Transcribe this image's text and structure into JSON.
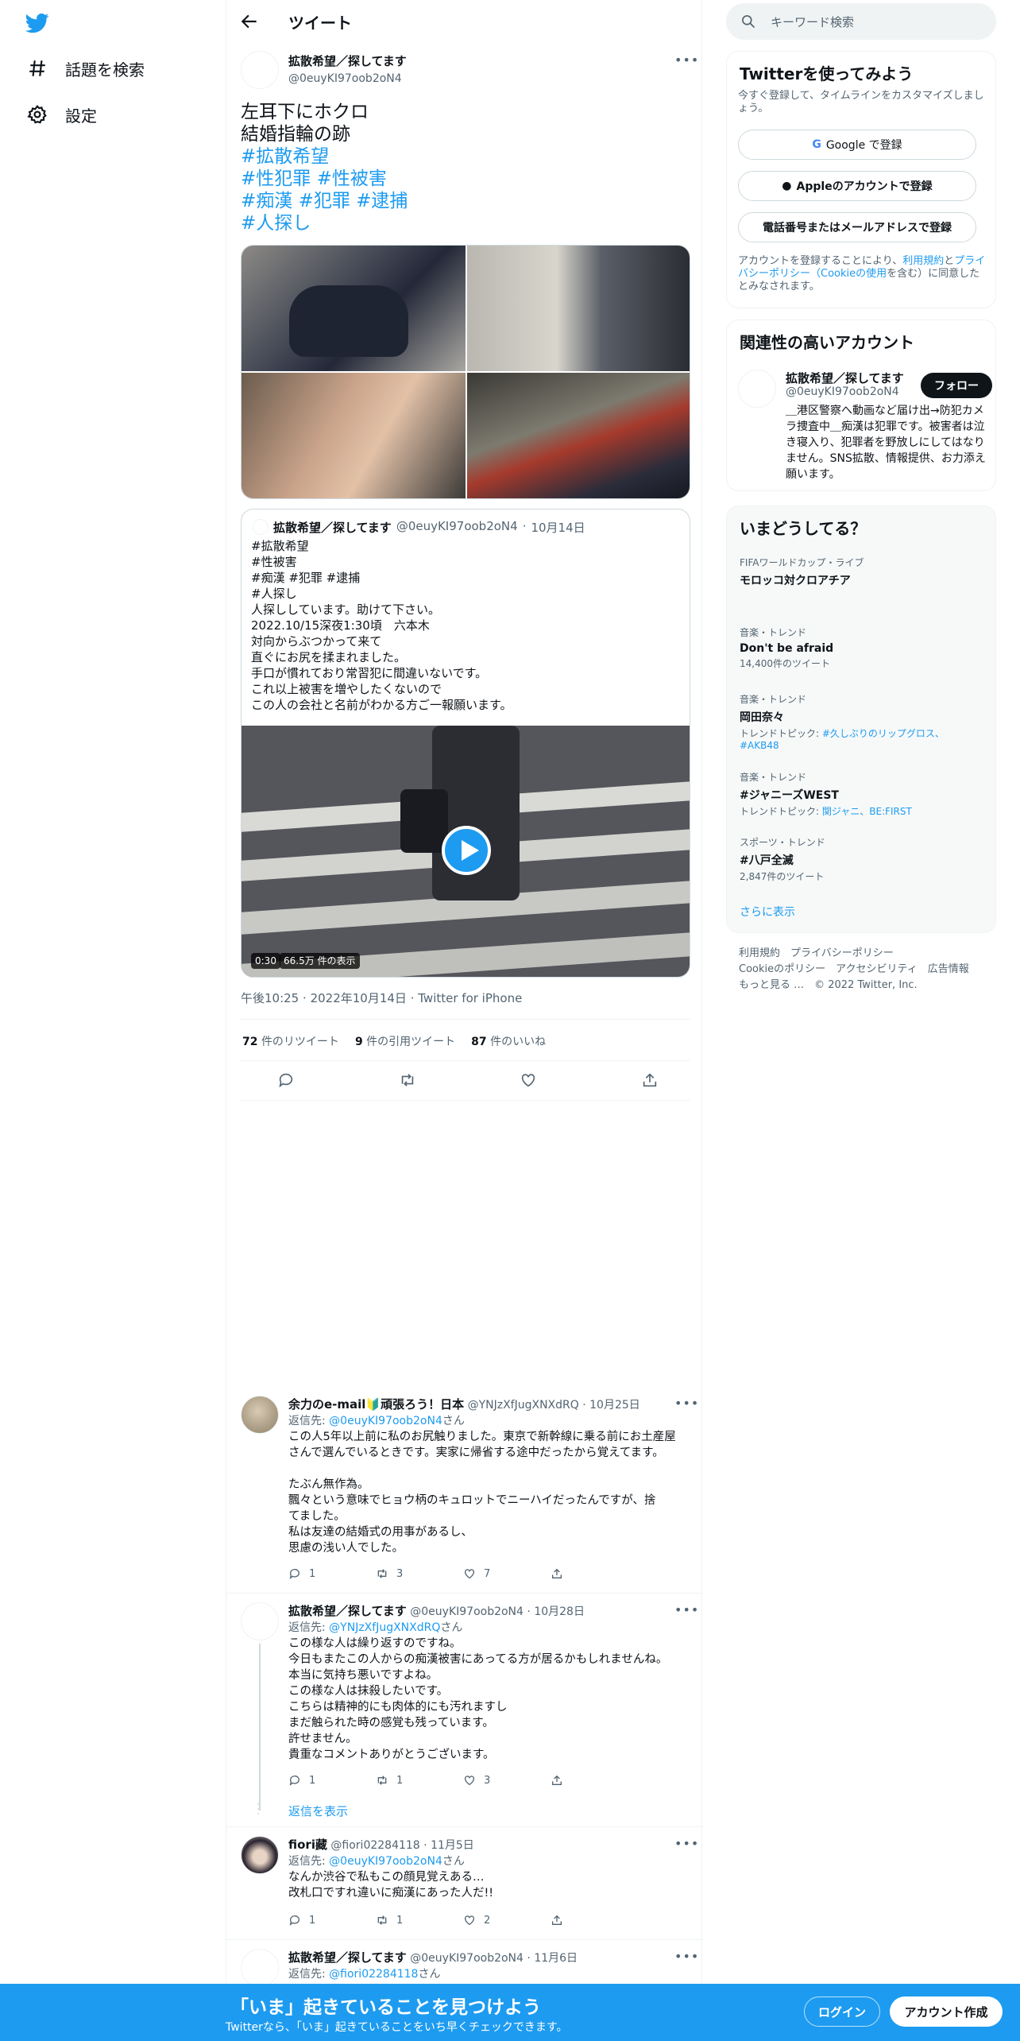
{
  "nav": {
    "items": [
      {
        "label": "話題を検索",
        "icon": "hashtag-icon"
      },
      {
        "label": "設定",
        "icon": "gear-icon"
      }
    ]
  },
  "header": {
    "title": "ツイート"
  },
  "tweet": {
    "author_name": "拡散希望／探してます",
    "author_handle": "@0euyKI97oob2oN4",
    "lines": [
      "左耳下にホクロ",
      "結婚指輪の跡"
    ],
    "hashtag_lines": [
      "#拡散希望",
      "#性犯罪 #性被害",
      "#痴漢 #犯罪 #逮捕",
      "#人探し"
    ],
    "time": "午後10:25",
    "date": "2022年10月14日",
    "source": "Twitter for iPhone",
    "stats": {
      "retweets_num": "72",
      "retweets_label": "件のリツイート",
      "quotes_num": "9",
      "quotes_label": "件の引用ツイート",
      "likes_num": "87",
      "likes_label": "件のいいね"
    }
  },
  "quote": {
    "author_name": "拡散希望／探してます",
    "author_handle": "@0euyKI97oob2oN4",
    "date": "10月14日",
    "lines": [
      "#拡散希望",
      "#性被害",
      "#痴漢 #犯罪 #逮捕",
      "#人探し",
      "人探ししています。助けて下さい。",
      "2022.10/15深夜1:30頃　六本木",
      "対向からぶつかって来て",
      "直ぐにお尻を揉まれました。",
      "手口が慣れており常習犯に間違いないです。",
      "これ以上被害を増やしたくないので",
      "この人の会社と名前がわかる方ご一報願います。"
    ],
    "video_duration": "0:30",
    "video_views": "66.5万 件の表示"
  },
  "replies": [
    {
      "name": "余力のe-mail🔰頑張ろう！日本",
      "handle": "@YNJzXfJugXNXdRQ",
      "date": "10月25日",
      "to_prefix": "返信先: ",
      "to": "@0euyKI97oob2oN4",
      "to_suffix": "さん",
      "lines": [
        "この人5年以上前に私のお尻触りました。東京で新幹線に乗る前にお土産屋",
        "さんで選んでいるときです。実家に帰省する途中だったから覚えてます。",
        "",
        "たぶん無作為。",
        "飄々という意味でヒョウ柄のキュロットでニーハイだったんですが、捨",
        "てました。",
        "私は友達の結婚式の用事があるし、",
        "思慮の浅い人でした。"
      ],
      "replies": "1",
      "retweets": "3",
      "likes": "7"
    },
    {
      "name": "拡散希望／探してます",
      "handle": "@0euyKI97oob2oN4",
      "date": "10月28日",
      "to_prefix": "返信先: ",
      "to": "@YNJzXfJugXNXdRQ",
      "to_suffix": "さん",
      "lines": [
        "この様な人は繰り返すのですね。",
        "今日もまたこの人からの痴漢被害にあってる方が居るかもしれませんね。",
        "本当に気持ち悪いですよね。",
        "この様な人は抹殺したいです。",
        "こちらは精神的にも肉体的にも汚れますし",
        "まだ触られた時の感覚も残っています。",
        "許せません。",
        "貴重なコメントありがとうございます。"
      ],
      "replies": "1",
      "retweets": "1",
      "likes": "3",
      "show_replies": "返信を表示"
    },
    {
      "name": "fiori藏",
      "handle": "@fiori02284118",
      "date": "11月5日",
      "to_prefix": "返信先: ",
      "to": "@0euyKI97oob2oN4",
      "to_suffix": "さん",
      "lines": [
        "なんか渋谷で私もこの顔見覚えある…",
        "改札口ですれ違いに痴漢にあった人だ!!"
      ],
      "replies": "1",
      "retweets": "1",
      "likes": "2"
    },
    {
      "name": "拡散希望／探してます",
      "handle": "@0euyKI97oob2oN4",
      "date": "11月6日",
      "to_prefix": "返信先: ",
      "to": "@fiori02284118",
      "to_suffix": "さん"
    }
  ],
  "search": {
    "placeholder": "キーワード検索"
  },
  "signup_card": {
    "title": "Twitterを使ってみよう",
    "subtitle": "今すぐ登録して、タイムラインをカスタマイズしましょう。",
    "google": "Google で登録",
    "apple": "Appleのアカウントで登録",
    "phone": "電話番号またはメールアドレスで登録",
    "terms_1": "アカウントを登録することにより、",
    "terms_link1": "利用規約",
    "terms_2": "と",
    "terms_link2": "プライバシーポリシー（Cookieの使用",
    "terms_3": "を含む）に同意したとみなされます。"
  },
  "related": {
    "title": "関連性の高いアカウント",
    "name": "拡散希望／探してます",
    "handle": "@0euyKI97oob2oN4",
    "follow": "フォロー",
    "bio": "＿港区警察へ動画など届け出→防犯カメラ捜査中＿痴漢は犯罪です。被害者は泣き寝入り、犯罪者を野放しにしてはなりません。SNS拡散、情報提供、お力添え願います。"
  },
  "trends": {
    "title": "いまどうしてる？",
    "items": [
      {
        "context": "FIFAワールドカップ・ライブ",
        "title": "モロッコ対クロアチア",
        "sub": ""
      },
      {
        "context": "音楽・トレンド",
        "title": "Don't be afraid",
        "sub": "14,400件のツイート"
      },
      {
        "context": "音楽・トレンド",
        "title": "岡田奈々",
        "sub_prefix": "トレンドトピック: ",
        "sub_links": "#久しぶりのリップグロス、#AKB48"
      },
      {
        "context": "音楽・トレンド",
        "title": "#ジャニーズWEST",
        "sub_prefix": "トレンドトピック: ",
        "sub_links": "関ジャニ、BE:FIRST"
      },
      {
        "context": "スポーツ・トレンド",
        "title": "#八戸全滅",
        "sub": "2,847件のツイート"
      }
    ],
    "show_more": "さらに表示"
  },
  "footer": {
    "line1": "利用規約　プライバシーポリシー",
    "line2": "Cookieのポリシー　アクセシビリティ　広告情報",
    "line3": "もっと見る …　© 2022 Twitter, Inc."
  },
  "bottom_bar": {
    "headline": "「いま」起きていることを見つけよう",
    "sub": "Twitterなら、「いま」起きていることをいち早くチェックできます。",
    "login": "ログイン",
    "signup": "アカウント作成"
  },
  "colors": {
    "accent": "#1d9bf0",
    "text": "#0f1419",
    "secondary": "#536471"
  }
}
